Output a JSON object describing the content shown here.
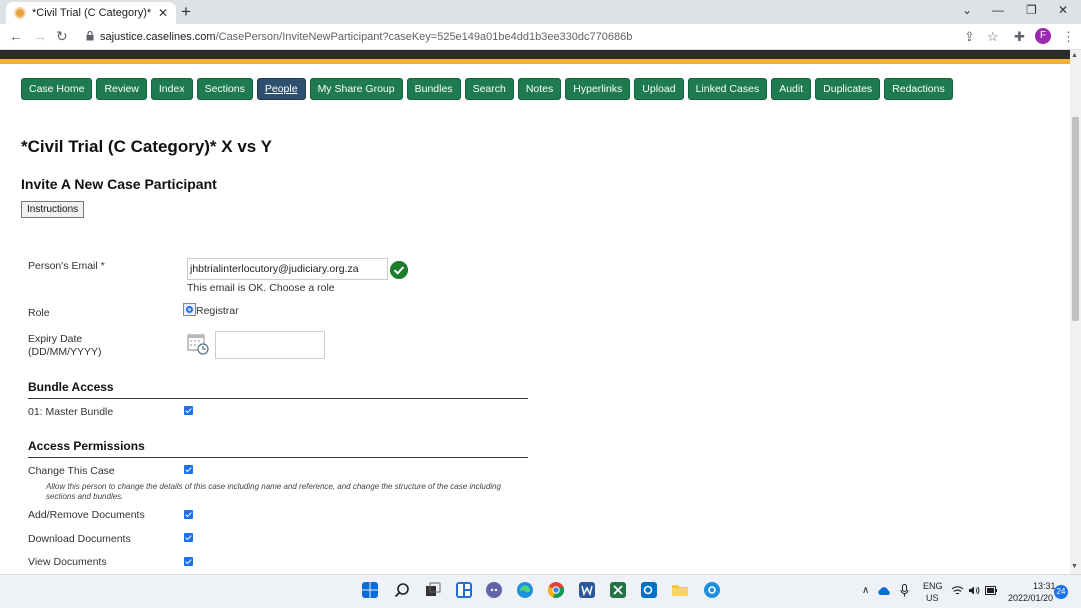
{
  "browser": {
    "tab_title": "*Civil Trial (C Category)* X vs Y | ",
    "url_domain": "sajustice.caselines.com",
    "url_path": "/CasePerson/InviteNewParticipant?caseKey=525e149a01be4dd1b3ee330dc770686b",
    "profile_initial": "F"
  },
  "nav": [
    {
      "label": "Case Home"
    },
    {
      "label": "Review"
    },
    {
      "label": "Index"
    },
    {
      "label": "Sections"
    },
    {
      "label": "People"
    },
    {
      "label": "My Share Group"
    },
    {
      "label": "Bundles"
    },
    {
      "label": "Search"
    },
    {
      "label": "Notes"
    },
    {
      "label": "Hyperlinks"
    },
    {
      "label": "Upload"
    },
    {
      "label": "Linked Cases"
    },
    {
      "label": "Audit"
    },
    {
      "label": "Duplicates"
    },
    {
      "label": "Redactions"
    }
  ],
  "page": {
    "case_title": "*Civil Trial (C Category)* X vs Y",
    "heading": "Invite A New Case Participant",
    "instructions_label": "Instructions"
  },
  "form": {
    "email_label": "Person's Email *",
    "email_value": "jhbtrialinterlocutory@judiciary.org.za",
    "email_ok": "This email is OK. Choose a role",
    "role_label": "Role",
    "role_option": "Registrar",
    "expiry_label_1": "Expiry Date",
    "expiry_label_2": "(DD/MM/YYYY)"
  },
  "bundle_access": {
    "title": "Bundle Access",
    "item": "01: Master Bundle"
  },
  "permissions": {
    "title": "Access Permissions",
    "change_case": "Change This Case",
    "change_case_help": "Allow this person to change the details of this case including name and reference, and change the structure of the case including sections and bundles.",
    "add_remove": "Add/Remove Documents",
    "download": "Download Documents",
    "view": "View Documents"
  },
  "taskbar": {
    "lang_1": "ENG",
    "lang_2": "US",
    "time": "13:31",
    "date": "2022/01/20",
    "badge": "24"
  },
  "colors": {
    "nav_green": "#1e7a4f",
    "nav_active": "#2f4f6f",
    "accent_gold": "#f2b233",
    "check_blue": "#1a73e8"
  }
}
